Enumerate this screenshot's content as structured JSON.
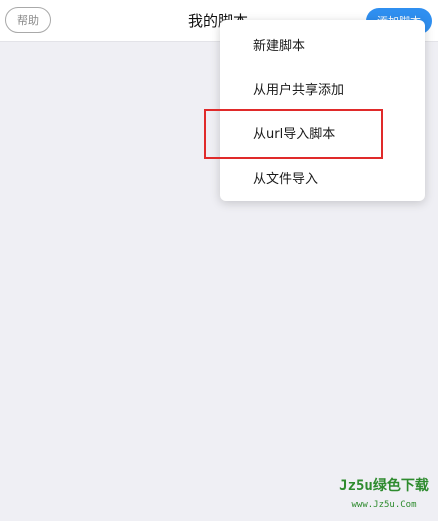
{
  "header": {
    "help_label": "帮助",
    "title": "我的脚本",
    "add_label": "添加脚本"
  },
  "menu": {
    "items": [
      {
        "label": "新建脚本"
      },
      {
        "label": "从用户共享添加"
      },
      {
        "label": "从url导入脚本"
      },
      {
        "label": "从文件导入"
      }
    ]
  },
  "watermark": {
    "brand": "Jz5u绿色下载",
    "url": "www.Jz5u.Com"
  },
  "colors": {
    "accent": "#2f8ff0",
    "background": "#efeff4",
    "highlight": "#e02a2a",
    "watermark": "#2e8b2e"
  }
}
